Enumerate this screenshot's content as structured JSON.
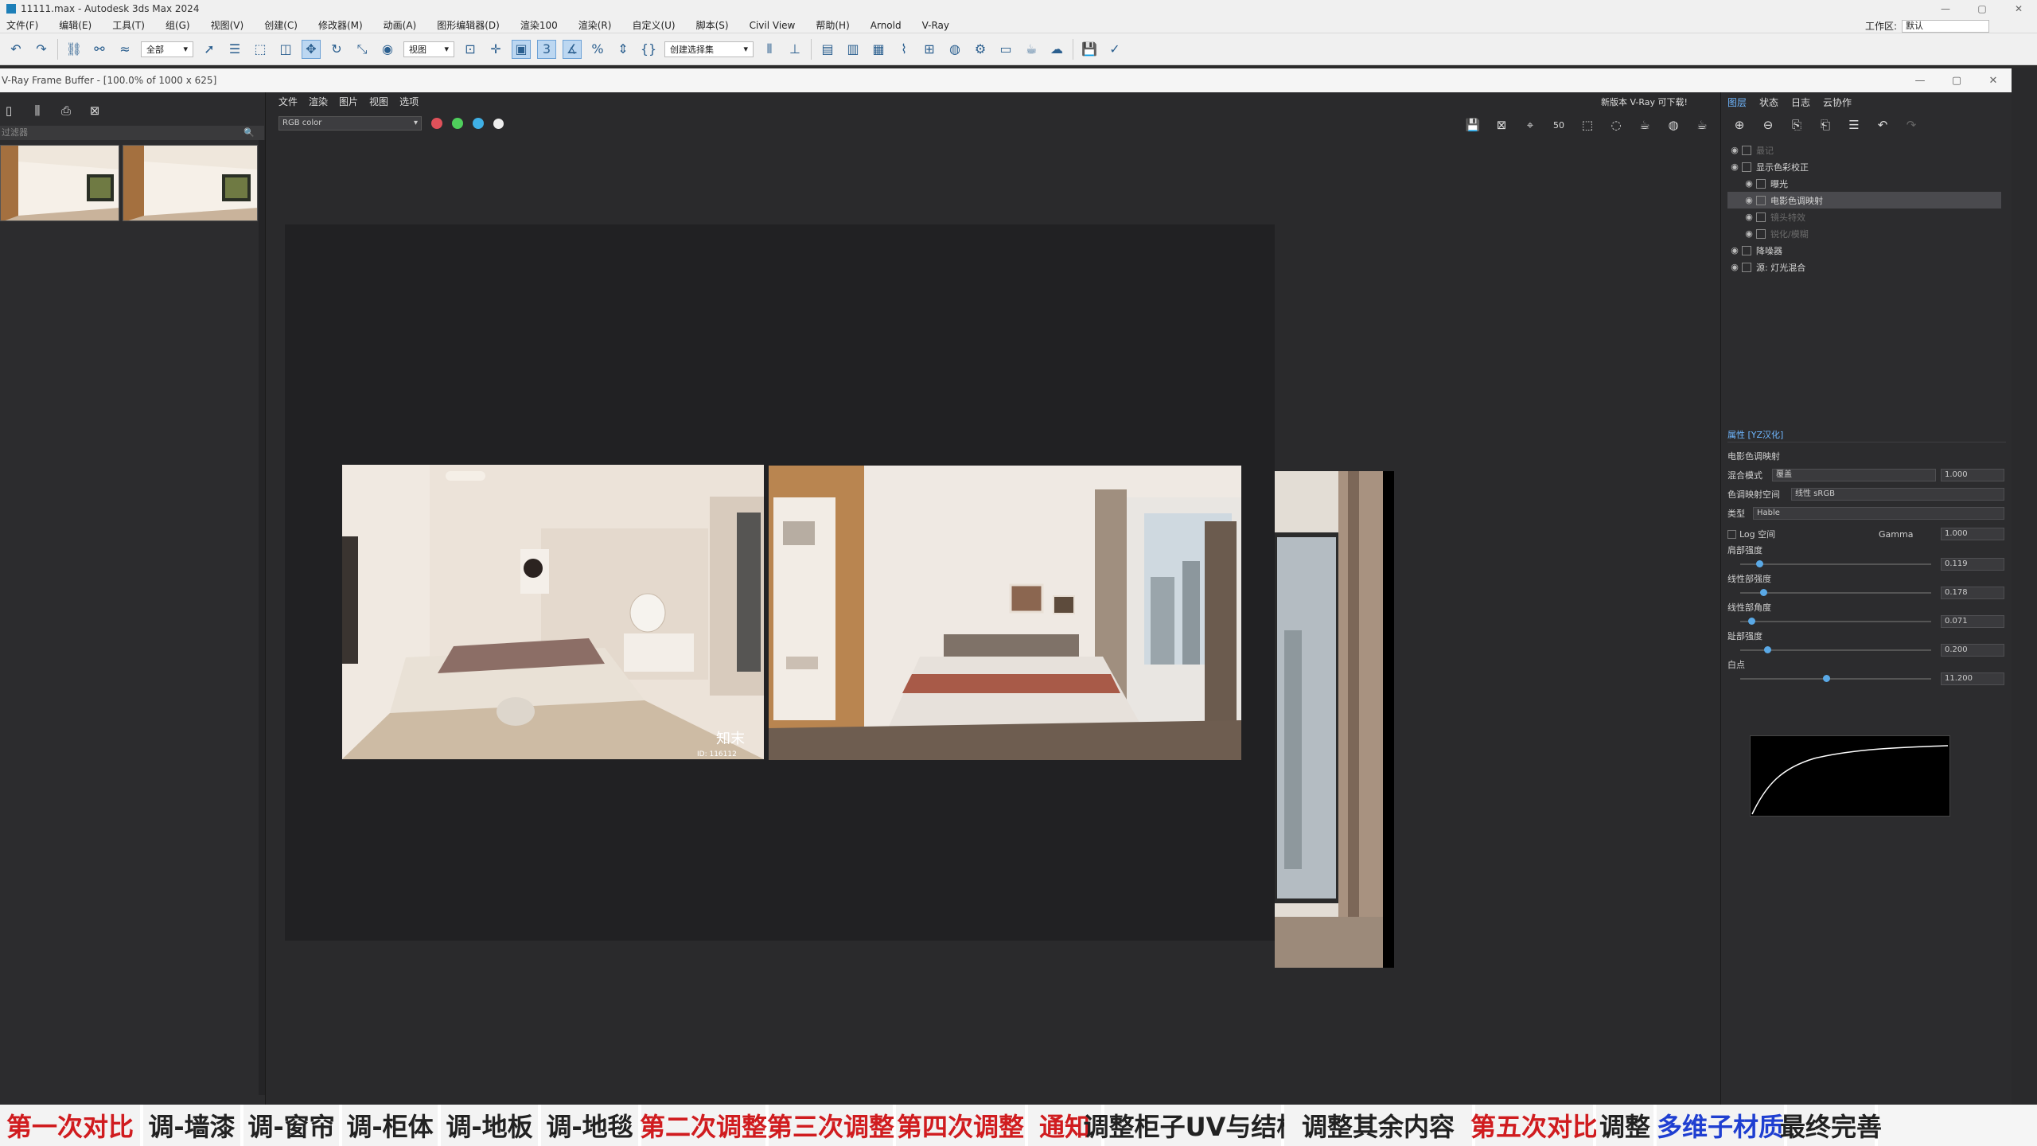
{
  "max_window": {
    "title": "11111.max - Autodesk 3ds Max 2024",
    "controls": [
      "—",
      "▢",
      "✕"
    ]
  },
  "menu": {
    "items": [
      "文件(F)",
      "编辑(E)",
      "工具(T)",
      "组(G)",
      "视图(V)",
      "创建(C)",
      "修改器(M)",
      "动画(A)",
      "图形编辑器(D)",
      "渲染100",
      "渲染(R)",
      "自定义(U)",
      "脚本(S)",
      "Civil View",
      "帮助(H)",
      "Arnold",
      "V-Ray"
    ],
    "workspace_label": "工作区:",
    "workspace_value": "默认"
  },
  "toolbar": {
    "filter_select": "全部",
    "view_select": "视图",
    "selection_set": "创建选择集"
  },
  "vfb": {
    "title": "V-Ray Frame Buffer - [100.0% of 1000 x 625]",
    "menu": [
      "文件",
      "渲染",
      "图片",
      "视图",
      "选项"
    ],
    "notice": "新版本 V-Ray 可下载!",
    "channel": "RGB color",
    "colors": {
      "red": "#e0515a",
      "green": "#4fcf5c",
      "blue": "#3fb0e6"
    }
  },
  "history": {
    "filter_placeholder": "过滤器"
  },
  "layers_panel": {
    "tabs": [
      "图层",
      "状态",
      "日志",
      "云协作"
    ],
    "rows": [
      {
        "label": "最记",
        "state": "dim"
      },
      {
        "label": "显示色彩校正",
        "state": "on"
      },
      {
        "label": "曝光",
        "state": "on"
      },
      {
        "label": "电影色调映射",
        "state": "sel"
      },
      {
        "label": "镜头特效",
        "state": "dim"
      },
      {
        "label": "锐化/模糊",
        "state": "dim"
      },
      {
        "label": "降噪器",
        "state": "on"
      },
      {
        "label": "源: 灯光混合",
        "state": "on"
      }
    ]
  },
  "properties": {
    "header": "属性 [YZ汉化]",
    "section": "电影色调映射",
    "blend_mode_label": "混合模式",
    "blend_mode_value": "覆盖",
    "blend_amount": "1.000",
    "tonemap_space_label": "色调映射空间",
    "tonemap_space_value": "线性 sRGB",
    "type_label": "类型",
    "type_value": "Hable",
    "log_space_label": "Log 空间",
    "gamma_label": "Gamma",
    "gamma_value": "1.000",
    "shoulder_strength_label": "肩部强度",
    "shoulder_strength_value": "0.119",
    "shoulder_strength_frac": 0.1,
    "linear_strength_label": "线性部强度",
    "linear_strength_value": "0.178",
    "linear_strength_frac": 0.12,
    "linear_angle_label": "线性部角度",
    "linear_angle_value": "0.071",
    "linear_angle_frac": 0.06,
    "toe_strength_label": "趾部强度",
    "toe_strength_value": "0.200",
    "toe_strength_frac": 0.14,
    "white_point_label": "白点",
    "white_point_value": "11.200",
    "white_point_frac": 0.45
  },
  "render": {
    "watermark": "知末",
    "watermark_id": "ID: 116112"
  },
  "captions": [
    {
      "text": "第一次对比",
      "color": "red"
    },
    {
      "text": "调-墙漆",
      "color": "black"
    },
    {
      "text": "调-窗帘",
      "color": "black"
    },
    {
      "text": "调-柜体",
      "color": "black"
    },
    {
      "text": "调-地板",
      "color": "black"
    },
    {
      "text": "调-地毯",
      "color": "black"
    },
    {
      "text": "第二次调整",
      "color": "red"
    },
    {
      "text": "第三次调整",
      "color": "red"
    },
    {
      "text": "第四次调整",
      "color": "red"
    },
    {
      "text": "通知",
      "color": "red"
    },
    {
      "text": "调整柜子UV与结构",
      "color": "black"
    },
    {
      "text": "调整其余内容",
      "color": "black"
    },
    {
      "text": "第五次对比",
      "color": "red"
    },
    {
      "text": "调整",
      "color": "black"
    },
    {
      "text": "多维子材质",
      "color": "blue"
    },
    {
      "text": "最终完善",
      "color": "black"
    }
  ]
}
